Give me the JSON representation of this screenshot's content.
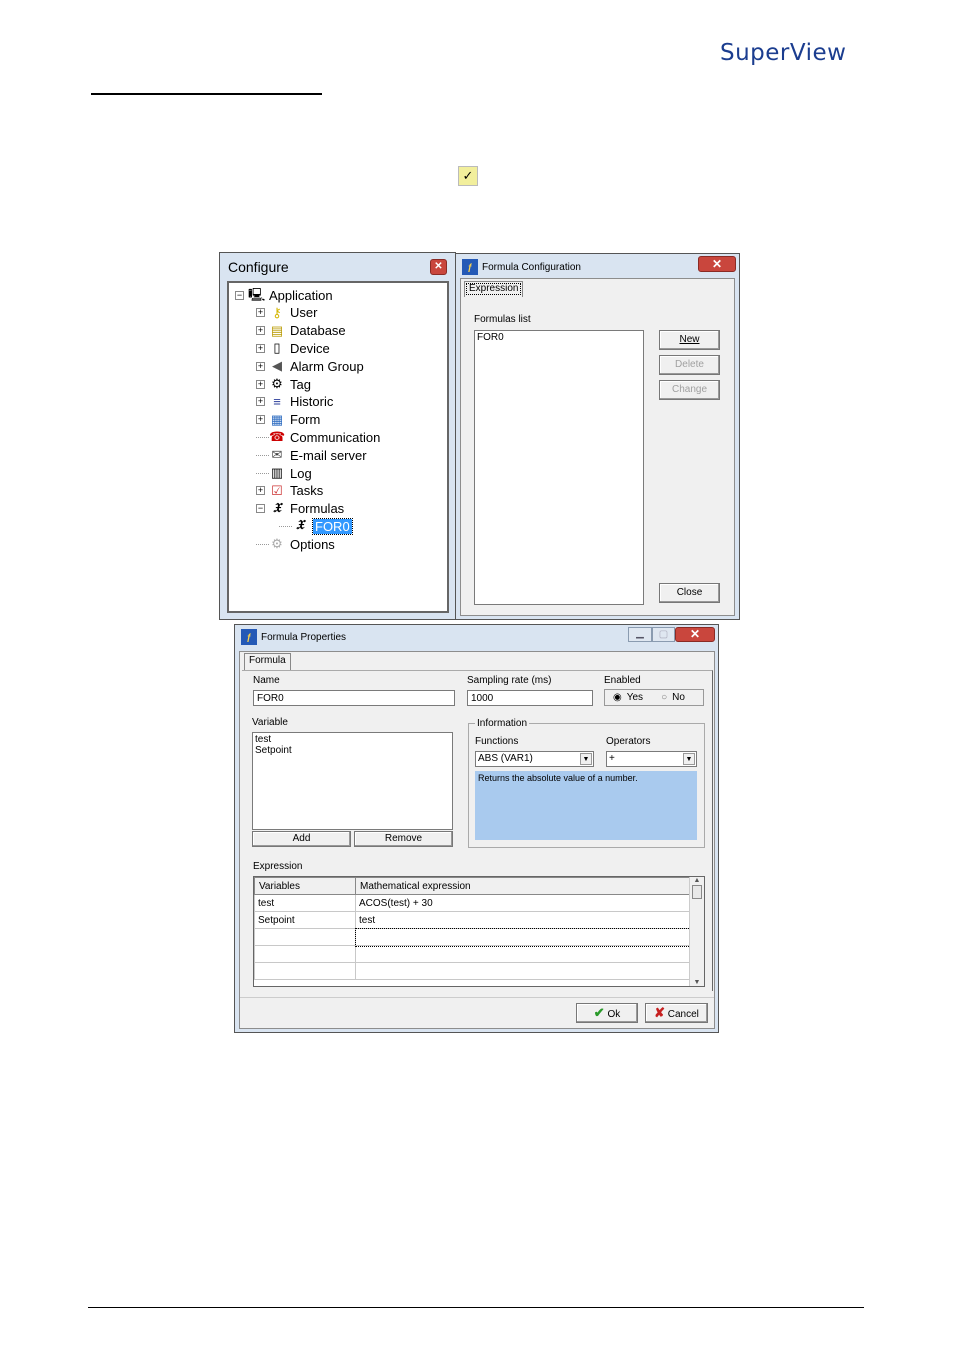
{
  "header": {
    "logo_text": "SuperView",
    "brand_color": "#1b3d8f"
  },
  "inline_icon": "task-checklist-icon",
  "configure_window": {
    "title": "Configure",
    "tree": [
      {
        "label": "Application",
        "icon": "computer-icon",
        "expander": "minus",
        "level": 0
      },
      {
        "label": "User",
        "icon": "key-icon",
        "expander": "plus",
        "level": 1
      },
      {
        "label": "Database",
        "icon": "cabinet-icon",
        "expander": "plus",
        "level": 1
      },
      {
        "label": "Device",
        "icon": "device-icon",
        "expander": "plus",
        "level": 1
      },
      {
        "label": "Alarm Group",
        "icon": "alarm-icon",
        "expander": "plus",
        "level": 1
      },
      {
        "label": "Tag",
        "icon": "tag-gears-icon",
        "expander": "plus",
        "level": 1
      },
      {
        "label": "Historic",
        "icon": "historic-icon",
        "expander": "plus",
        "level": 1
      },
      {
        "label": "Form",
        "icon": "form-icon",
        "expander": "plus",
        "level": 1
      },
      {
        "label": "Communication",
        "icon": "phone-icon",
        "expander": "none",
        "level": 1
      },
      {
        "label": "E-mail server",
        "icon": "envelope-icon",
        "expander": "none",
        "level": 1
      },
      {
        "label": "Log",
        "icon": "log-icon",
        "expander": "none",
        "level": 1
      },
      {
        "label": "Tasks",
        "icon": "tasks-icon",
        "expander": "plus",
        "level": 1
      },
      {
        "label": "Formulas",
        "icon": "formula-icon",
        "expander": "minus",
        "level": 1
      },
      {
        "label": "FOR0",
        "icon": "formula-icon",
        "expander": "none",
        "level": 2,
        "selected": true
      },
      {
        "label": "Options",
        "icon": "gear-icon",
        "expander": "none",
        "level": 1
      }
    ]
  },
  "formula_config": {
    "title": "Formula Configuration",
    "tab": "Expression",
    "list_label": "Formulas list",
    "list_items": [
      "FOR0"
    ],
    "buttons": {
      "new": "New",
      "delete": "Delete",
      "change": "Change",
      "close": "Close"
    }
  },
  "formula_props": {
    "title": "Formula Properties",
    "tab": "Formula",
    "name_label": "Name",
    "name_value": "FOR0",
    "sampling_label": "Sampling rate (ms)",
    "sampling_value": "1000",
    "enabled_label": "Enabled",
    "enabled_yes": "Yes",
    "enabled_no": "No",
    "enabled_selected": "Yes",
    "variable_label": "Variable",
    "variables": [
      "test",
      "Setpoint"
    ],
    "add_label": "Add",
    "remove_label": "Remove",
    "info_label": "Information",
    "functions_label": "Functions",
    "functions_value": "ABS (VAR1)",
    "operators_label": "Operators",
    "operators_value": "+",
    "description": "Returns the absolute value of a number.",
    "expression_label": "Expression",
    "grid_headers": [
      "Variables",
      "Mathematical expression"
    ],
    "grid_rows": [
      [
        "test",
        "ACOS(test) + 30"
      ],
      [
        "Setpoint",
        "test"
      ],
      [
        "",
        ""
      ],
      [
        "",
        ""
      ],
      [
        "",
        ""
      ]
    ],
    "ok_label": "Ok",
    "cancel_label": "Cancel"
  }
}
